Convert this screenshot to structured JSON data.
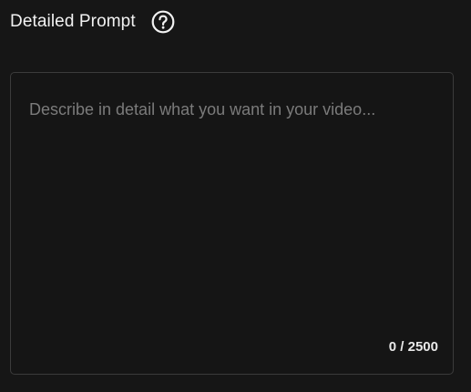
{
  "prompt_section": {
    "title": "Detailed Prompt",
    "help_icon": "question-circle-icon",
    "input": {
      "value": "",
      "placeholder": "Describe in detail what you want in your video..."
    },
    "counter": "0 / 2500"
  },
  "colors": {
    "background": "#161616",
    "border": "#3b3b3b",
    "text": "#f2f2f2",
    "placeholder": "#7b7b7b"
  }
}
